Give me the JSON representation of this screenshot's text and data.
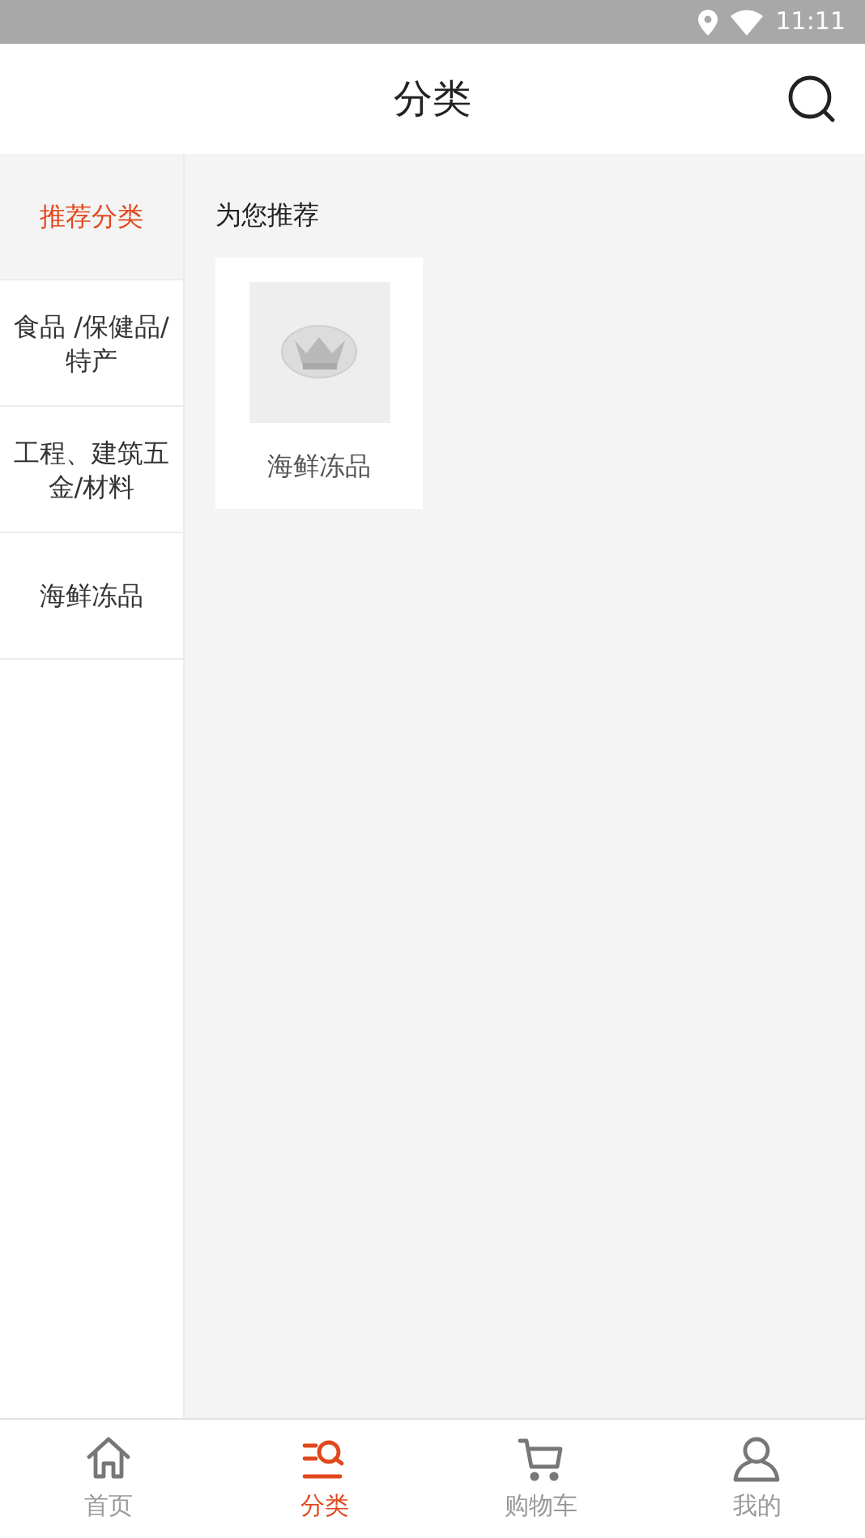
{
  "status_bar": {
    "time": "11:11"
  },
  "header": {
    "title": "分类"
  },
  "sidebar": {
    "items": [
      {
        "label": "推荐分类",
        "selected": true
      },
      {
        "label": "食品 /保健品/特产",
        "selected": false
      },
      {
        "label": "工程、建筑五金/材料",
        "selected": false
      },
      {
        "label": "海鲜冻品",
        "selected": false
      }
    ]
  },
  "content": {
    "heading": "为您推荐",
    "cards": [
      {
        "label": "海鲜冻品",
        "kind": "picture"
      }
    ]
  },
  "tab_bar": {
    "tabs": [
      {
        "label": "首页",
        "kind": "home",
        "selected": false
      },
      {
        "label": "分类",
        "kind": "category",
        "selected": true
      },
      {
        "label": "购物车",
        "kind": "cart",
        "selected": false
      },
      {
        "label": "我的",
        "kind": "profile",
        "selected": false
      }
    ]
  }
}
